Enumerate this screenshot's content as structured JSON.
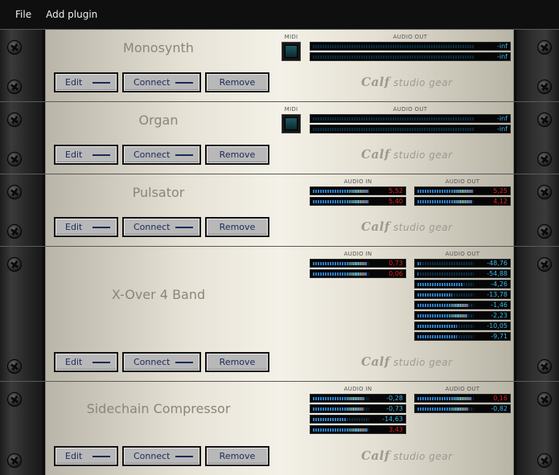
{
  "menu": [
    {
      "label": "File"
    },
    {
      "label": "Add plugin"
    }
  ],
  "labels": {
    "midi": "MIDI",
    "audio_in": "AUDIO IN",
    "audio_out": "AUDIO OUT",
    "brand_main": "Calf",
    "brand_sub": "studio gear"
  },
  "buttons": {
    "edit": "Edit",
    "connect": "Connect",
    "remove": "Remove"
  },
  "plugins": [
    {
      "name": "Monosynth",
      "midi": true,
      "audio_in": [],
      "audio_out": [
        {
          "value": "-inf",
          "level": 0.0,
          "alert": false
        },
        {
          "value": "-inf",
          "level": 0.0,
          "alert": false
        }
      ]
    },
    {
      "name": "Organ",
      "midi": true,
      "audio_in": [],
      "audio_out": [
        {
          "value": "-inf",
          "level": 0.0,
          "alert": false
        },
        {
          "value": "-inf",
          "level": 0.0,
          "alert": false
        }
      ]
    },
    {
      "name": "Pulsator",
      "midi": false,
      "audio_in": [
        {
          "value": "5,52",
          "level": 0.98,
          "alert": true
        },
        {
          "value": "5,40",
          "level": 0.98,
          "alert": true
        }
      ],
      "audio_out": [
        {
          "value": "5,25",
          "level": 0.98,
          "alert": true
        },
        {
          "value": "4,12",
          "level": 0.97,
          "alert": true
        }
      ]
    },
    {
      "name": "X-Over 4 Band",
      "midi": false,
      "audio_in": [
        {
          "value": "0,73",
          "level": 0.95,
          "alert": true
        },
        {
          "value": "0,06",
          "level": 0.95,
          "alert": true
        }
      ],
      "audio_out": [
        {
          "value": "-48,76",
          "level": 0.05,
          "alert": false
        },
        {
          "value": "-54,88",
          "level": 0.02,
          "alert": false
        },
        {
          "value": "-4,26",
          "level": 0.82,
          "alert": false
        },
        {
          "value": "-13,78",
          "level": 0.62,
          "alert": false
        },
        {
          "value": "-1,46",
          "level": 0.9,
          "alert": false
        },
        {
          "value": "-2,23",
          "level": 0.88,
          "alert": false
        },
        {
          "value": "-10,05",
          "level": 0.7,
          "alert": false
        },
        {
          "value": "-9,71",
          "level": 0.7,
          "alert": false
        }
      ]
    },
    {
      "name": "Sidechain Compressor",
      "midi": false,
      "audio_in": [
        {
          "value": "-0,28",
          "level": 0.92,
          "alert": false
        },
        {
          "value": "-0,73",
          "level": 0.9,
          "alert": false
        },
        {
          "value": "-14,63",
          "level": 0.58,
          "alert": false
        },
        {
          "value": "3,43",
          "level": 0.97,
          "alert": true
        }
      ],
      "audio_out": [
        {
          "value": "0,16",
          "level": 0.95,
          "alert": true
        },
        {
          "value": "-0,82",
          "level": 0.9,
          "alert": false
        }
      ]
    }
  ]
}
